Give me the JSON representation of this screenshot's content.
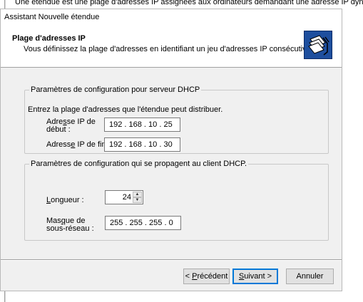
{
  "background": {
    "text": "Une étendue est une plage d'adresses IP assignées aux ordinateurs demandant une adresse IP dynam"
  },
  "window": {
    "title": "Assistant Nouvelle étendue"
  },
  "header": {
    "title": "Plage d'adresses IP",
    "subtitle": "Vous définissez la plage d'adresses en identifiant un jeu d'adresses IP consécutives.",
    "icon": "folder-stack-icon"
  },
  "server_config": {
    "legend": "Paramètres de configuration pour serveur DHCP",
    "instruction": "Entrez la plage d'adresses que l'étendue peut distribuer.",
    "start_ip": {
      "label_line1_pre": "Adre",
      "label_line1_u": "s",
      "label_line1_post": "se IP de",
      "label_line2": "début :",
      "value": "192 . 168 .  10  .  25"
    },
    "end_ip": {
      "label_pre": "Adress",
      "label_u": "e",
      "label_post": " IP de fin :",
      "value": "192 . 168 .  10  .  30"
    }
  },
  "client_config": {
    "legend": "Paramètres de configuration qui se propagent au client DHCP.",
    "length": {
      "label_u": "L",
      "label_rest": "ongueur :",
      "value": "24"
    },
    "subnet_mask": {
      "label_line1_pre": "Mas",
      "label_line1_u": "q",
      "label_line1_post": "ue de",
      "label_line2": "sous-réseau :",
      "value": "255 . 255 . 255 .  0"
    }
  },
  "buttons": {
    "prev_pre": "< ",
    "prev_u": "P",
    "prev_post": "récédent",
    "next_u": "S",
    "next_post": "uivant >",
    "cancel": "Annuler"
  }
}
